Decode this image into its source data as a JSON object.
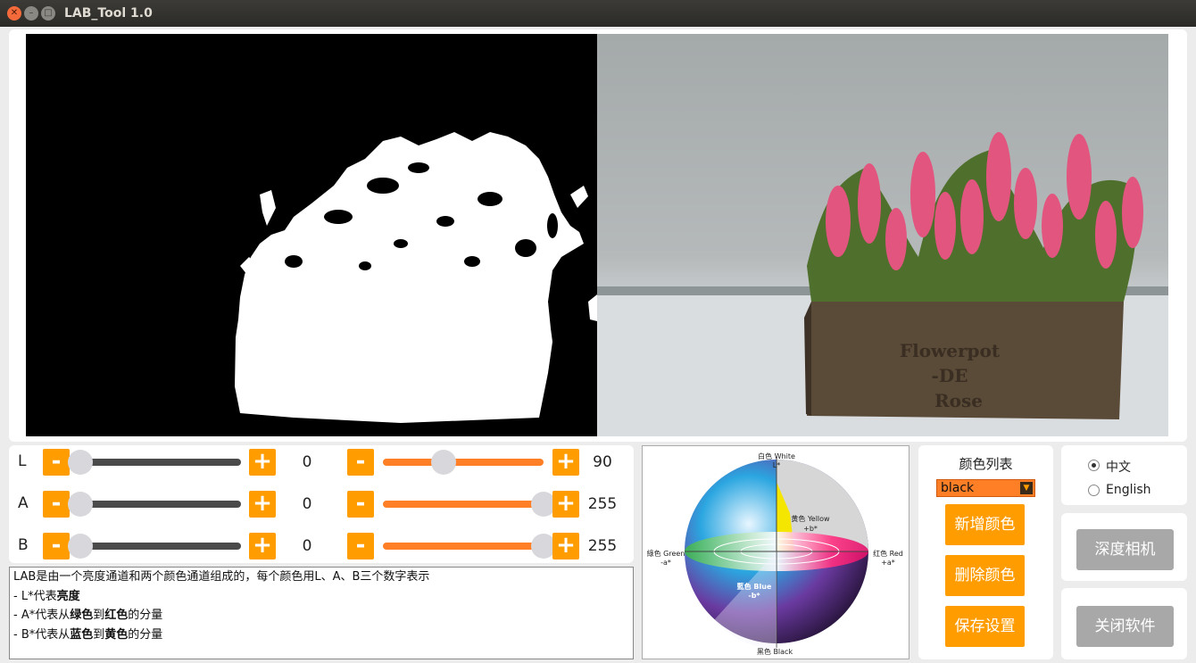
{
  "window": {
    "title": "LAB_Tool 1.0",
    "close": "✕",
    "minimize": "–",
    "maximize": "□"
  },
  "sliders": [
    {
      "axis": "L",
      "min_value": "0",
      "max_value": "90",
      "min_frac": 0.0,
      "max_frac": 0.38
    },
    {
      "axis": "A",
      "min_value": "0",
      "max_value": "255",
      "min_frac": 0.0,
      "max_frac": 1.0
    },
    {
      "axis": "B",
      "min_value": "0",
      "max_value": "255",
      "min_frac": 0.0,
      "max_frac": 1.0
    }
  ],
  "buttons": {
    "minus": "-",
    "plus": "+"
  },
  "description": {
    "line1": "LAB是由一个亮度通道和两个颜色通道组成的，每个颜色用L、A、B三个数字表示",
    "line2_pre": "- L*代表",
    "line2_bold": "亮度",
    "line3_pre": "- A*代表从",
    "line3_b1": "绿色",
    "line3_mid": "到",
    "line3_b2": "红色",
    "line3_post": "的分量",
    "line4_pre": "- B*代表从",
    "line4_b1": "蓝色",
    "line4_mid": "到",
    "line4_b2": "黄色",
    "line4_post": "的分量"
  },
  "lab_diagram": {
    "white": "白色 White",
    "l_axis": "L*",
    "yellow": "黄色 Yellow",
    "plus_b": "+b*",
    "green": "綠色 Green",
    "minus_a": "-a*",
    "red": "红色 Red",
    "plus_a": "+a*",
    "blue": "藍色 Blue",
    "minus_b": "-b*",
    "black": "黑色 Black"
  },
  "color_list": {
    "title": "颜色列表",
    "selected": "black",
    "add": "新增颜色",
    "delete": "删除颜色",
    "save": "保存设置"
  },
  "language": {
    "options": [
      {
        "label": "中文",
        "selected": true
      },
      {
        "label": "English",
        "selected": false
      }
    ]
  },
  "actions": {
    "depth_camera": "深度相机",
    "close_app": "关闭软件"
  },
  "camera_scene": {
    "box_text_1": "Flowerpot",
    "box_text_2": "-DE",
    "box_text_3": "Rose"
  },
  "colors": {
    "accent": "#ff9d00",
    "track_active": "#ff7f26",
    "track_inactive": "#4a4a4a",
    "disabled_button": "#a8a8a8"
  }
}
